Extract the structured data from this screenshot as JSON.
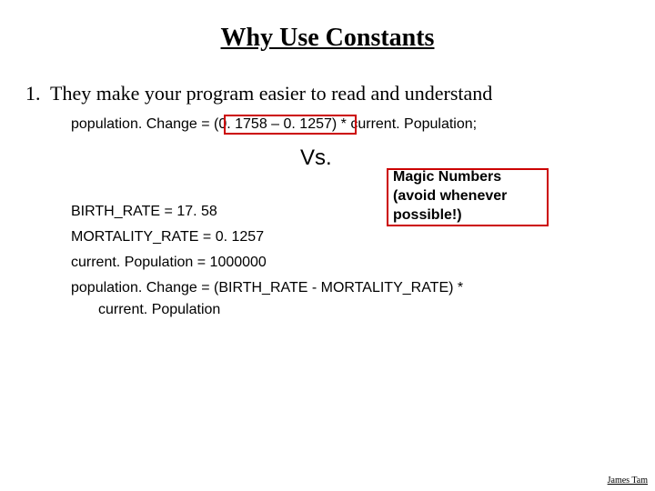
{
  "title": "Why Use Constants",
  "list": {
    "number": "1.",
    "text": "They make your program easier to read and understand"
  },
  "vs": "Vs.",
  "code": {
    "line1": "population. Change = (0. 1758 – 0. 1257) * current. Population;",
    "line2": "BIRTH_RATE = 17. 58",
    "line3": "MORTALITY_RATE = 0. 1257",
    "line4": "current. Population = 1000000",
    "line5a": "population. Change = (BIRTH_RATE - MORTALITY_RATE) *",
    "line5b": "current. Population"
  },
  "callout": {
    "line1": "Magic Numbers",
    "line2": "(avoid whenever",
    "line3": "possible!)"
  },
  "author": "James Tam"
}
